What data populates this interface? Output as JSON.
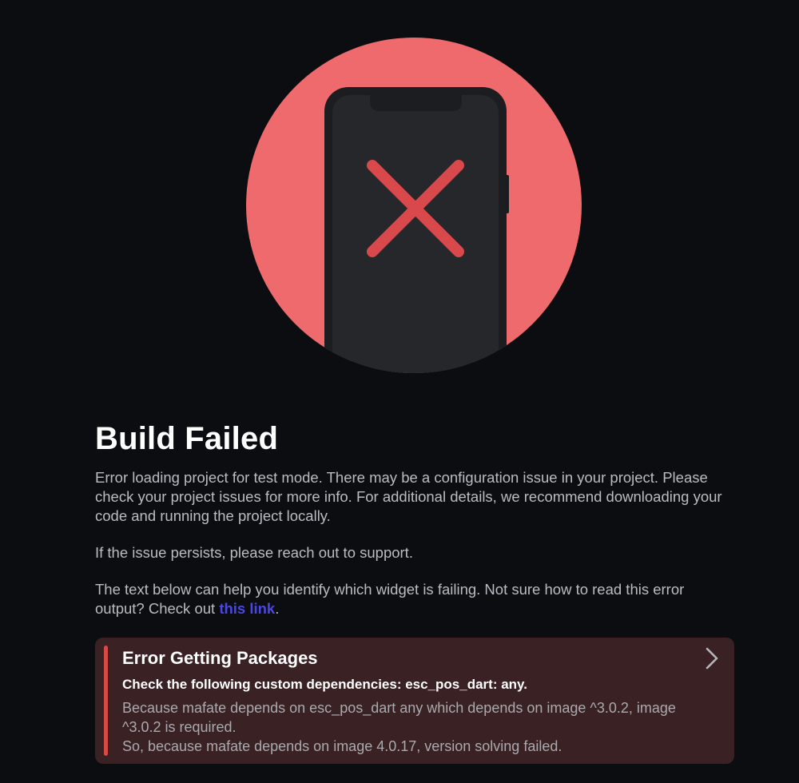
{
  "illustration": {
    "icon": "phone-error-icon",
    "circle_color": "#ef6a6c",
    "phone_color": "#25272b",
    "x_color": "#d9484a"
  },
  "page": {
    "title": "Build Failed",
    "paragraph_1": "Error loading project for test mode. There may be a configuration issue in your project. Please check your project issues for more info. For additional details, we recommend downloading your code and running the project locally.",
    "paragraph_2": "If the issue persists, please reach out to support.",
    "paragraph_3_before_link": "The text below can help you identify which widget is failing. Not sure how to read this error output? Check out ",
    "paragraph_3_link": "this link",
    "paragraph_3_after_link": "."
  },
  "error_card": {
    "title": "Error Getting Packages",
    "subtitle": "Check the following custom dependencies: esc_pos_dart: any.",
    "detail_line_1": "Because mafate depends on esc_pos_dart any which depends on image ^3.0.2, image ^3.0.2 is required.",
    "detail_line_2": "So, because mafate depends on image 4.0.17, version solving failed.",
    "accent_color": "#d94a47",
    "background_color": "#3a2124",
    "expand_icon": "chevron-right-icon"
  },
  "colors": {
    "background": "#0b0d11",
    "link": "#4a47e6"
  }
}
